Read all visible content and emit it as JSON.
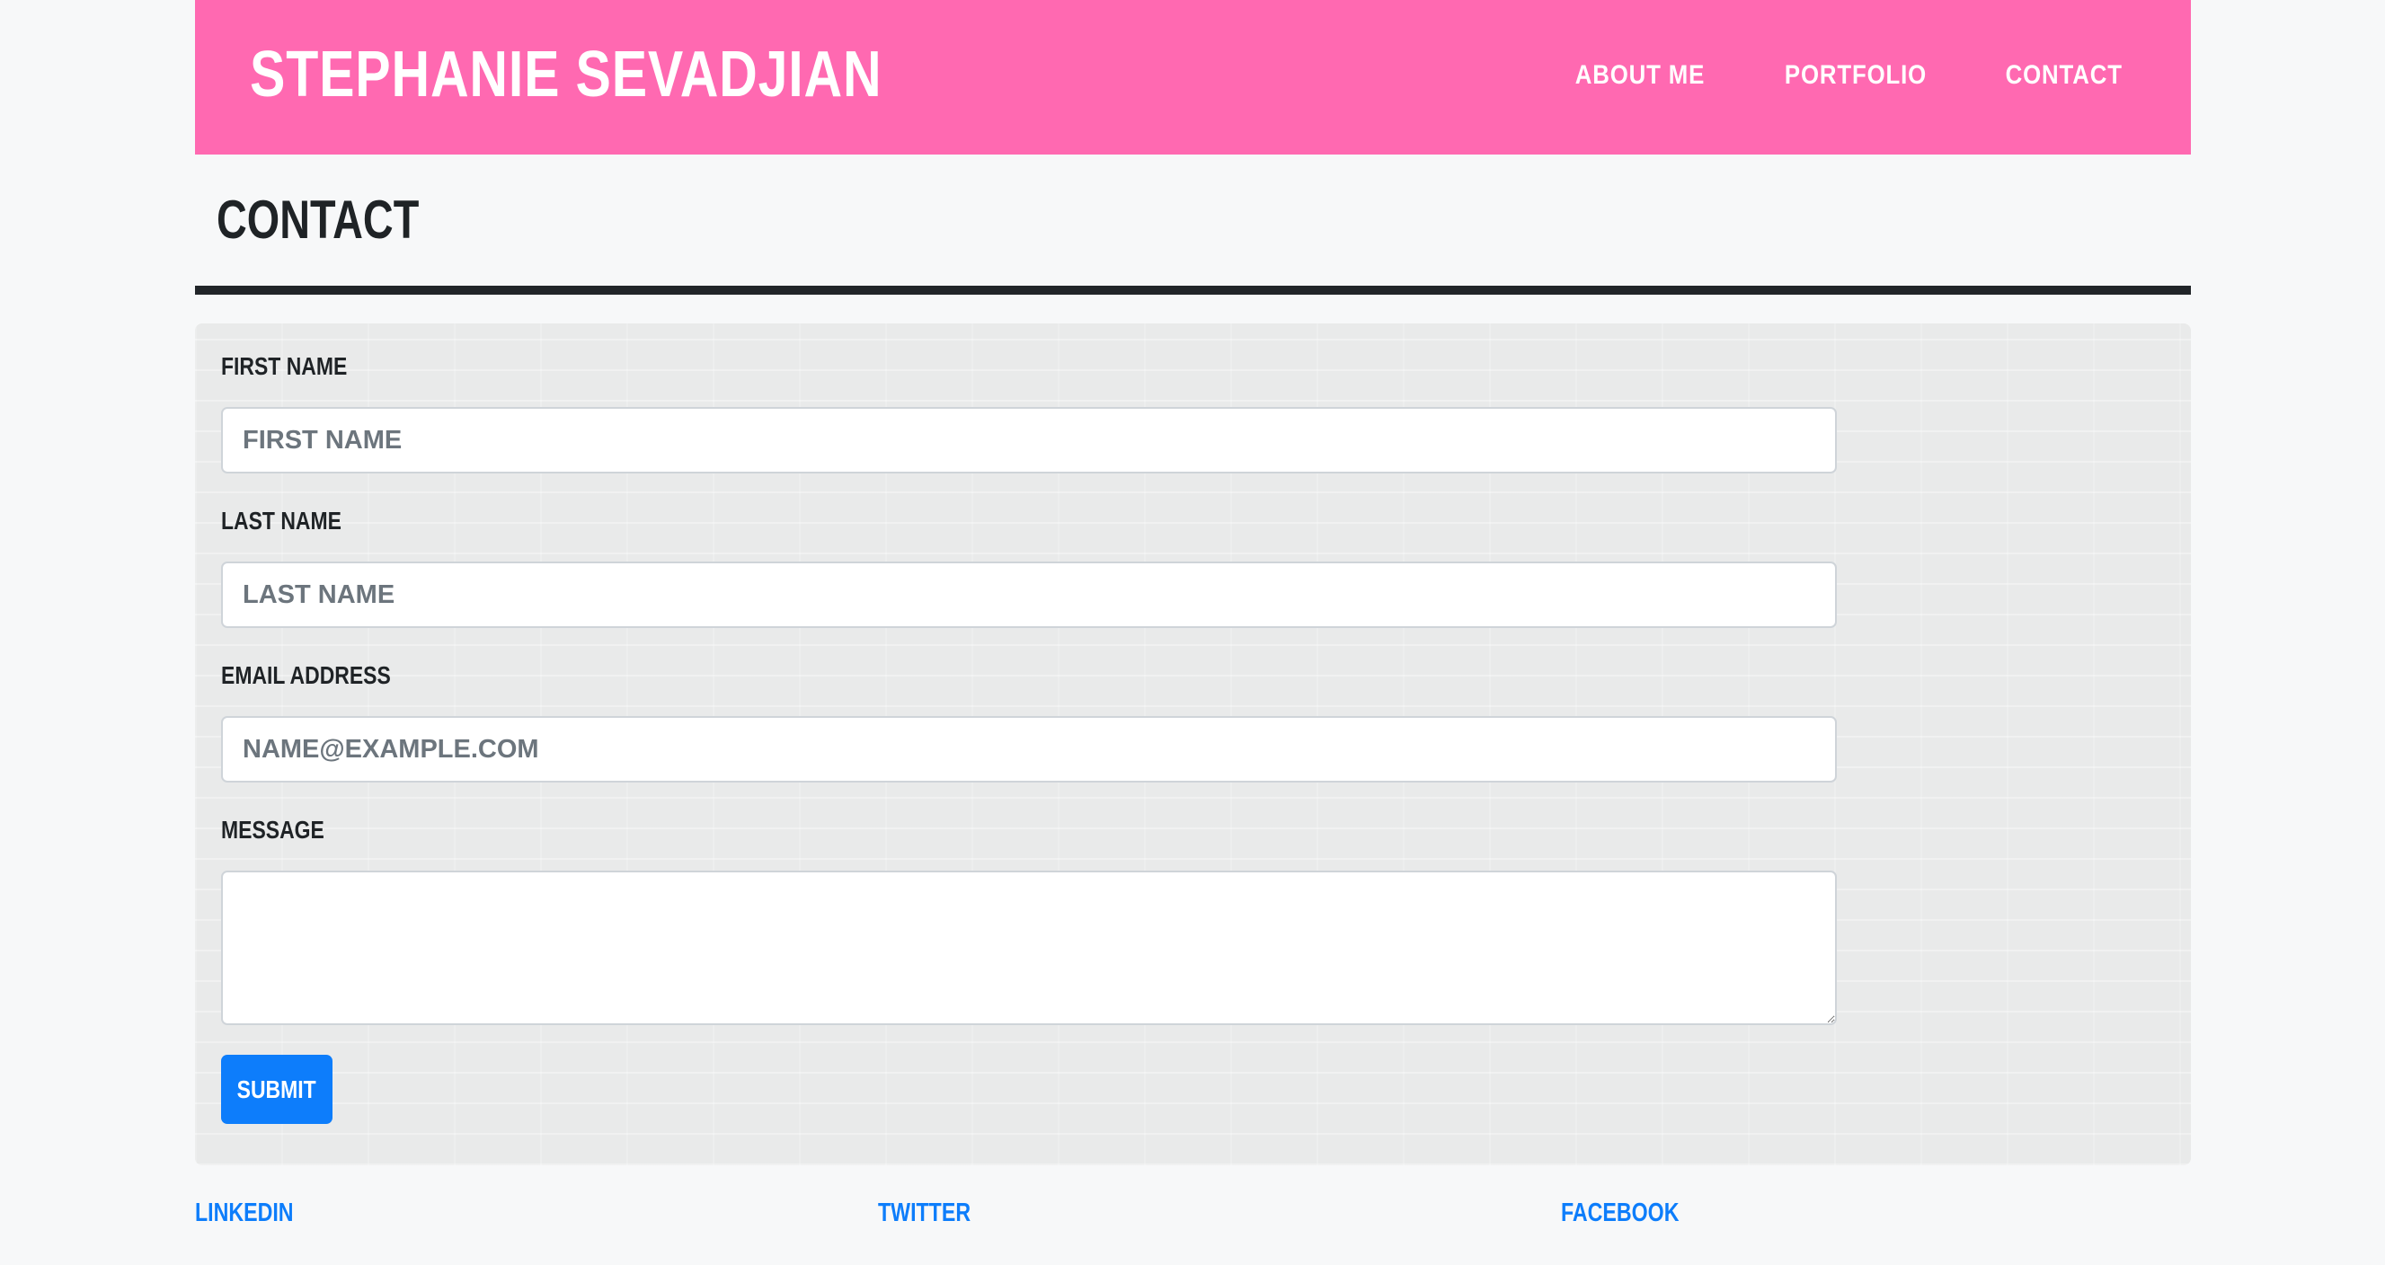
{
  "header": {
    "brand": "STEPHANIE SEVADJIAN",
    "nav": [
      {
        "label": "ABOUT ME"
      },
      {
        "label": "PORTFOLIO"
      },
      {
        "label": "CONTACT"
      }
    ],
    "background_color": "#ff69b1"
  },
  "page": {
    "title": "CONTACT"
  },
  "form": {
    "first_name": {
      "label": "FIRST NAME",
      "placeholder": "FIRST NAME",
      "value": ""
    },
    "last_name": {
      "label": "LAST NAME",
      "placeholder": "LAST NAME",
      "value": ""
    },
    "email": {
      "label": "EMAIL ADDRESS",
      "placeholder": "NAME@EXAMPLE.COM",
      "value": ""
    },
    "message": {
      "label": "MESSAGE",
      "value": ""
    },
    "submit_label": "SUBMIT",
    "submit_color": "#0d7dfb"
  },
  "footer": {
    "links": [
      {
        "label": "LINKEDIN"
      },
      {
        "label": "TWITTER"
      },
      {
        "label": "FACEBOOK"
      }
    ],
    "link_color": "#0d7dfb"
  }
}
